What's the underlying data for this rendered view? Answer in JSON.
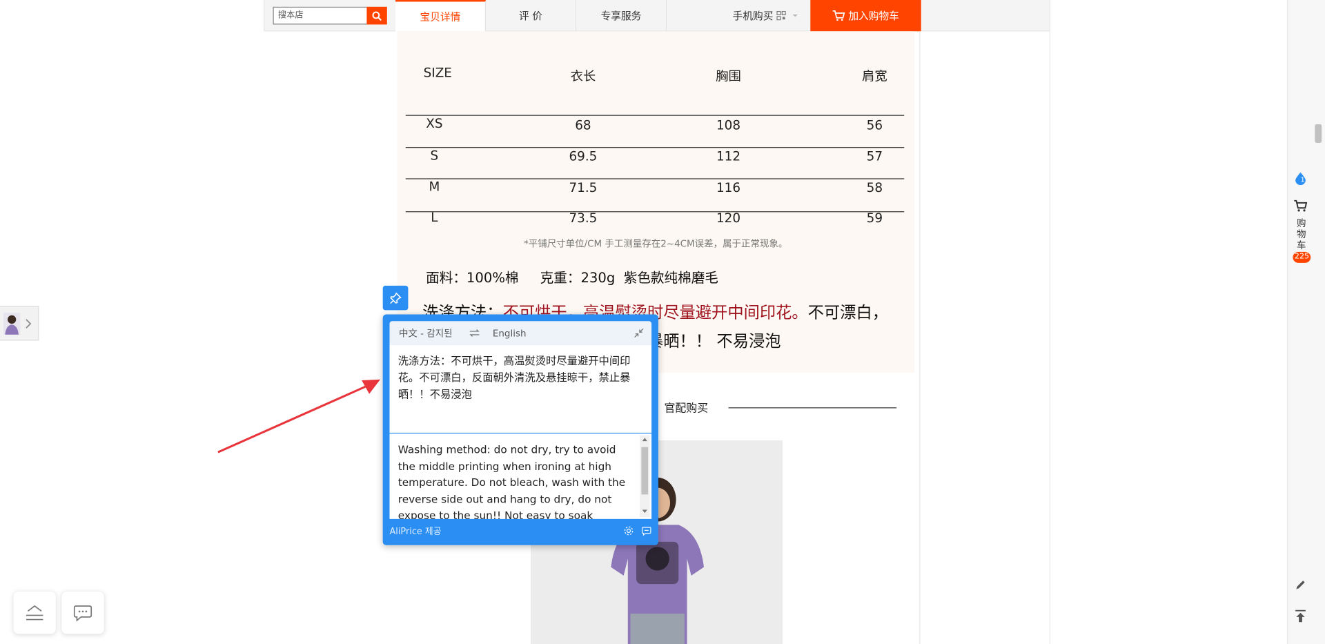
{
  "topbar": {
    "search_placeholder": "搜本店",
    "tabs": [
      "宝贝详情",
      "评  价",
      "专享服务"
    ],
    "mobile_buy": "手机购买",
    "add_to_cart": "加入购物车"
  },
  "size_table": {
    "headers": [
      "SIZE",
      "衣长",
      "胸围",
      "肩宽"
    ],
    "rows": [
      [
        "XS",
        "68",
        "108",
        "56"
      ],
      [
        "S",
        "69.5",
        "112",
        "57"
      ],
      [
        "M",
        "71.5",
        "116",
        "58"
      ],
      [
        "L",
        "73.5",
        "120",
        "59"
      ]
    ],
    "note": "*平铺尺寸单位/CM   手工测量存在2~4CM误差，属于正常现象。"
  },
  "fabric_line": "面料：100%棉     克重：230g  紫色款纯棉磨毛",
  "wash": {
    "prefix": "洗涤方法：",
    "red": "不可烘干，高温熨烫时尽量避开中间印花。",
    "suffix": "不可漂白，",
    "line2": "反面朝外清洗及悬挂晾干，禁止暴晒！！ 不易浸泡"
  },
  "official_buy": "官配购买",
  "sidebar": {
    "cart_label": "购物车",
    "cart_count": "225",
    "msg_count": "1"
  },
  "translator": {
    "source_lang": "中文 - 감지된",
    "target_lang": "English",
    "source_text": "洗涤方法：不可烘干，高温熨烫时尽量避开中间印花。不可漂白，反面朝外清洗及悬挂晾干，禁止暴晒！！不易浸泡",
    "translated_text": "Washing method: do not dry, try to avoid the middle printing when ironing at high temperature. Do not bleach, wash with the reverse side out and hang to dry, do not expose to the sun!! Not easy to soak",
    "provider": "AliPrice 제공"
  }
}
